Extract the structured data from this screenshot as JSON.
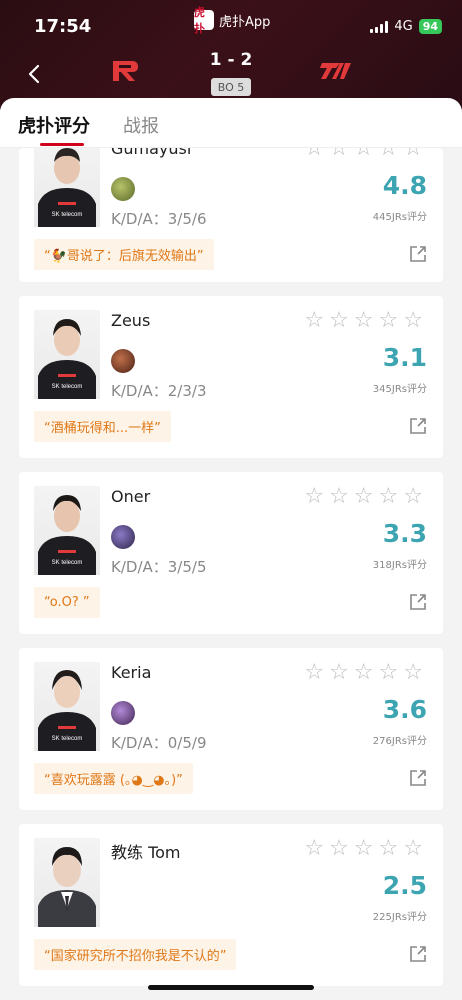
{
  "status": {
    "time": "17:54",
    "network": "4G",
    "battery": "94"
  },
  "app": {
    "icon_text": "虎扑",
    "name": "虎扑App"
  },
  "match": {
    "score": "1 - 2",
    "format": "BO 5",
    "team_a": "R",
    "team_b": "T1"
  },
  "tabs": {
    "active": "虎扑评分",
    "inactive": "战报"
  },
  "colors": {
    "header": "#2a0d12",
    "accent": "#d0021b",
    "rating": "#3da5b2",
    "quote_text": "#e07818",
    "quote_bg": "#fdf3e6"
  },
  "players": [
    {
      "name": "Gumayusi",
      "kda": "K/D/A：3/5/6",
      "rating": "4.8",
      "count": "445JRs评分",
      "quote": "“🐓哥说了：后旗无效输出”"
    },
    {
      "name": "Zeus",
      "kda": "K/D/A：2/3/3",
      "rating": "3.1",
      "count": "345JRs评分",
      "quote": "“酒桶玩得和...一样”"
    },
    {
      "name": "Oner",
      "kda": "K/D/A：3/5/5",
      "rating": "3.3",
      "count": "318JRs评分",
      "quote": "“o.O? ”"
    },
    {
      "name": "Keria",
      "kda": "K/D/A：0/5/9",
      "rating": "3.6",
      "count": "276JRs评分",
      "quote": "“喜欢玩露露 (｡◕‿◕｡)”"
    },
    {
      "name": "教练 Tom",
      "kda": "",
      "rating": "2.5",
      "count": "225JRs评分",
      "quote": "“国家研究所不招你我是不认的”"
    }
  ]
}
